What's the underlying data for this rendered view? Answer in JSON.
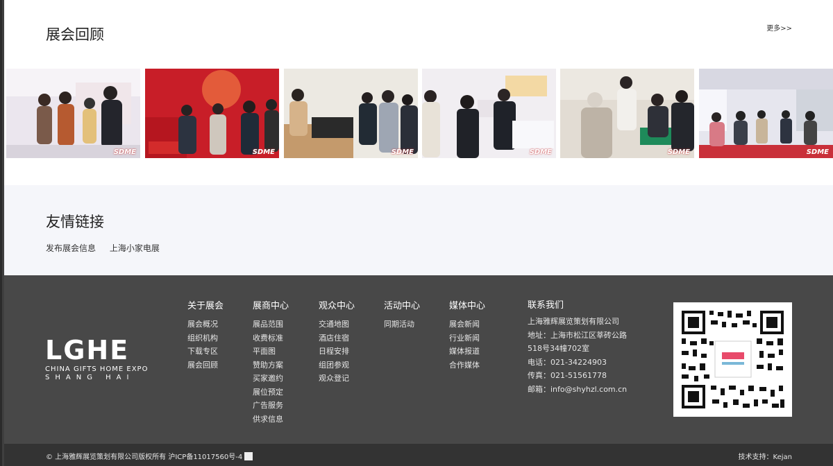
{
  "review": {
    "title": "展会回顾",
    "more": "更多>>",
    "watermark": "SDME",
    "photos": [
      {
        "name": "expo-photo-1",
        "bg": "#e9e4ea"
      },
      {
        "name": "expo-photo-2",
        "bg": "#c8202a"
      },
      {
        "name": "expo-photo-3",
        "bg": "#ecebe6"
      },
      {
        "name": "expo-photo-4",
        "bg": "#f1f0f3"
      },
      {
        "name": "expo-photo-5",
        "bg": "#e3ddd5"
      },
      {
        "name": "expo-photo-6",
        "bg": "#e8e8ef"
      }
    ]
  },
  "links": {
    "title": "友情链接",
    "items": [
      "发布展会信息",
      "上海小家电展"
    ]
  },
  "footer": {
    "logo_main": "LGHE",
    "logo_line1": "CHINA GIFTS HOME EXPO",
    "logo_line2": "SHANG HAI",
    "columns": [
      {
        "head": "关于展会",
        "items": [
          "展会概况",
          "组织机构",
          "下载专区",
          "展会回顾"
        ]
      },
      {
        "head": "展商中心",
        "items": [
          "展品范围",
          "收费标准",
          "平面图",
          "赞助方案",
          "买家邀约",
          "展位预定",
          "广告服务",
          "供求信息"
        ]
      },
      {
        "head": "观众中心",
        "items": [
          "交通地图",
          "酒店住宿",
          "日程安排",
          "组团参观",
          "观众登记"
        ]
      },
      {
        "head": "活动中心",
        "items": [
          "同期活动"
        ]
      },
      {
        "head": "媒体中心",
        "items": [
          "展会新闻",
          "行业新闻",
          "媒体报道",
          "合作媒体"
        ]
      }
    ],
    "contact": {
      "head": "联系我们",
      "company": "上海雅辉展览策划有限公司",
      "address1": "地址：上海市松江区莘砖公路",
      "address2": "518号34幢702室",
      "phone": "电话：021-34224903",
      "fax": "传真：021-51561778",
      "email": "邮箱：info@shyhzl.com.cn"
    }
  },
  "bottom": {
    "copyright": "© 上海雅辉展览策划有限公司版权所有 沪ICP备11017560号-4",
    "tech": "技术支持：Kejan"
  }
}
